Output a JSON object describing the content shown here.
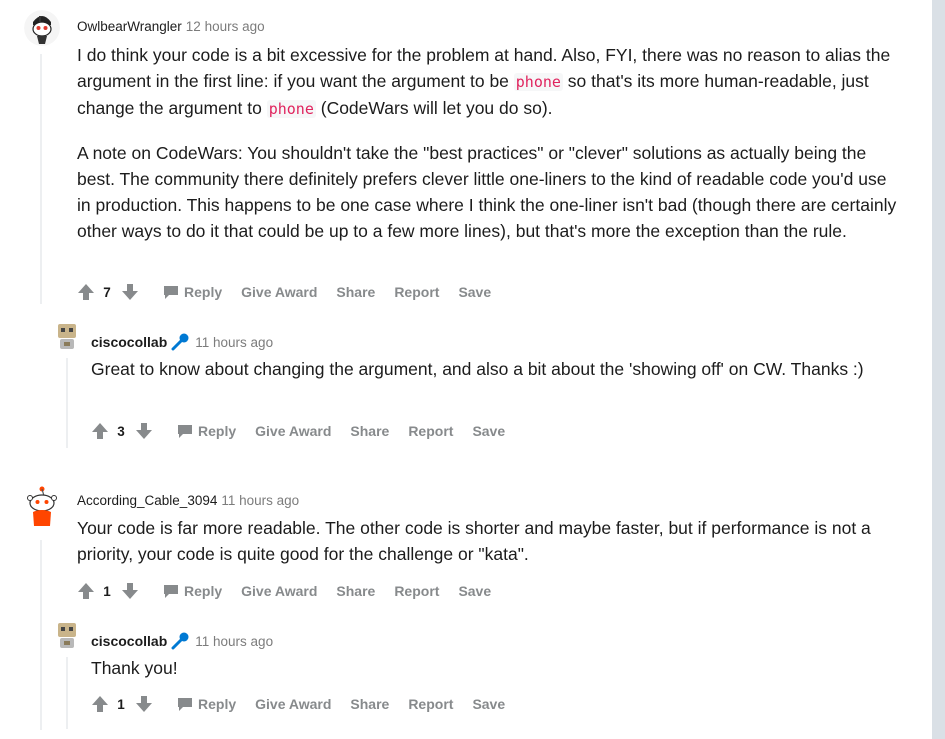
{
  "comments": [
    {
      "author": "OwlbearWrangler",
      "time": "12 hours ago",
      "paragraphs": [
        {
          "t1": "I do think your code is a bit excessive for the problem at hand. Also, FYI, there was no reason to alias the argument in the first line: if you want the argument to be ",
          "code1": "phone",
          "t2": " so that's its more human-readable, just change the argument to ",
          "code2": "phone",
          "t3": " (CodeWars will let you do so)."
        },
        {
          "text": "A note on CodeWars: You shouldn't take the \"best practices\" or \"clever\" solutions as actually being the best. The community there definitely prefers clever little one-liners to the kind of readable code you'd use in production. This happens to be one case where I think the one-liner isn't bad (though there are certainly other ways to do it that could be up to a few more lines), but that's more the exception than the rule."
        }
      ],
      "score": "7"
    },
    {
      "author": "ciscocollab",
      "time": "11 hours ago",
      "text": "Great to know about changing the argument, and also a bit about the 'showing off' on CW. Thanks :)",
      "score": "3"
    },
    {
      "author": "According_Cable_3094",
      "time": "11 hours ago",
      "text": "Your code is far more readable. The other code is shorter and maybe faster, but if performance is not a priority, your code is quite good for the challenge or \"kata\".",
      "score": "1"
    },
    {
      "author": "ciscocollab",
      "time": "11 hours ago",
      "text": "Thank you!",
      "score": "1"
    }
  ],
  "actions": {
    "reply": "Reply",
    "give_award": "Give Award",
    "share": "Share",
    "report": "Report",
    "save": "Save"
  },
  "colors": {
    "page_bg": "#dae0e6",
    "text": "#1c1c1c",
    "meta": "#7c7c7c",
    "action": "#878a8c",
    "code": "#e0245e",
    "flair": "#0079d3"
  },
  "icons": [
    "upvote-icon",
    "downvote-icon",
    "comment-icon",
    "microphone-flair-icon"
  ]
}
